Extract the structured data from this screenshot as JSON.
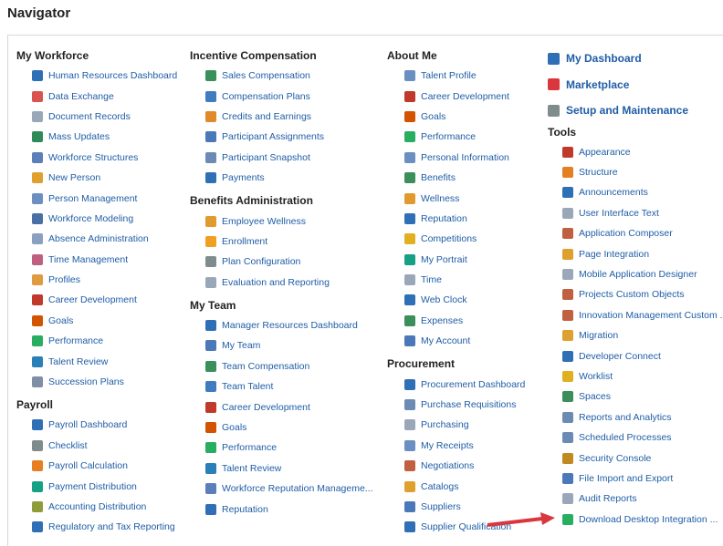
{
  "page": {
    "title": "Navigator"
  },
  "columns": [
    {
      "sections": [
        {
          "title": "My Workforce",
          "items": [
            {
              "label": "Human Resources Dashboard",
              "icon": "dashboard-icon",
              "color": "#2e6fb6"
            },
            {
              "label": "Data Exchange",
              "icon": "data-exchange-icon",
              "color": "#d9534f"
            },
            {
              "label": "Document Records",
              "icon": "document-icon",
              "color": "#9aa7b8"
            },
            {
              "label": "Mass Updates",
              "icon": "mass-update-icon",
              "color": "#2e8b57"
            },
            {
              "label": "Workforce Structures",
              "icon": "structures-icon",
              "color": "#5b7fb8"
            },
            {
              "label": "New Person",
              "icon": "new-person-icon",
              "color": "#e0a030"
            },
            {
              "label": "Person Management",
              "icon": "person-icon",
              "color": "#6a8fc0"
            },
            {
              "label": "Workforce Modeling",
              "icon": "modeling-icon",
              "color": "#4a6fa5"
            },
            {
              "label": "Absence Administration",
              "icon": "absence-icon",
              "color": "#8aa0c0"
            },
            {
              "label": "Time Management",
              "icon": "time-icon",
              "color": "#c06080"
            },
            {
              "label": "Profiles",
              "icon": "profiles-icon",
              "color": "#e09a40"
            },
            {
              "label": "Career Development",
              "icon": "career-icon",
              "color": "#c0392b"
            },
            {
              "label": "Goals",
              "icon": "goals-icon",
              "color": "#d35400"
            },
            {
              "label": "Performance",
              "icon": "performance-icon",
              "color": "#27ae60"
            },
            {
              "label": "Talent Review",
              "icon": "talent-review-icon",
              "color": "#2980b9"
            },
            {
              "label": "Succession Plans",
              "icon": "succession-icon",
              "color": "#7f8fa6"
            }
          ]
        },
        {
          "title": "Payroll",
          "items": [
            {
              "label": "Payroll Dashboard",
              "icon": "dashboard-icon",
              "color": "#2e6fb6"
            },
            {
              "label": "Checklist",
              "icon": "checklist-icon",
              "color": "#7f8c8d"
            },
            {
              "label": "Payroll Calculation",
              "icon": "calculation-icon",
              "color": "#e67e22"
            },
            {
              "label": "Payment Distribution",
              "icon": "payment-icon",
              "color": "#16a085"
            },
            {
              "label": "Accounting Distribution",
              "icon": "accounting-icon",
              "color": "#8e9d3a"
            },
            {
              "label": "Regulatory and Tax Reporting",
              "icon": "tax-icon",
              "color": "#2e6fb6"
            }
          ]
        }
      ]
    },
    {
      "sections": [
        {
          "title": "Incentive Compensation",
          "items": [
            {
              "label": "Sales Compensation",
              "icon": "sales-comp-icon",
              "color": "#3a8f5a"
            },
            {
              "label": "Compensation Plans",
              "icon": "comp-plans-icon",
              "color": "#3f7cc0"
            },
            {
              "label": "Credits and Earnings",
              "icon": "credits-icon",
              "color": "#e08a2a"
            },
            {
              "label": "Participant Assignments",
              "icon": "assignments-icon",
              "color": "#4a78b8"
            },
            {
              "label": "Participant Snapshot",
              "icon": "snapshot-icon",
              "color": "#6b8bb5"
            },
            {
              "label": "Payments",
              "icon": "payments-icon",
              "color": "#2e6fb6"
            }
          ]
        },
        {
          "title": "Benefits Administration",
          "items": [
            {
              "label": "Employee Wellness",
              "icon": "wellness-icon",
              "color": "#e09a30"
            },
            {
              "label": "Enrollment",
              "icon": "enrollment-icon",
              "color": "#f0a020"
            },
            {
              "label": "Plan Configuration",
              "icon": "plan-config-icon",
              "color": "#7f8c8d"
            },
            {
              "label": "Evaluation and Reporting",
              "icon": "evaluation-icon",
              "color": "#9aa7b8"
            }
          ]
        },
        {
          "title": "My Team",
          "items": [
            {
              "label": "Manager Resources Dashboard",
              "icon": "dashboard-icon",
              "color": "#2e6fb6"
            },
            {
              "label": "My Team",
              "icon": "team-icon",
              "color": "#4a78b8"
            },
            {
              "label": "Team Compensation",
              "icon": "team-comp-icon",
              "color": "#3a8f5a"
            },
            {
              "label": "Team Talent",
              "icon": "team-talent-icon",
              "color": "#3f7cc0"
            },
            {
              "label": "Career Development",
              "icon": "career-icon",
              "color": "#c0392b"
            },
            {
              "label": "Goals",
              "icon": "goals-icon",
              "color": "#d35400"
            },
            {
              "label": "Performance",
              "icon": "performance-icon",
              "color": "#27ae60"
            },
            {
              "label": "Talent Review",
              "icon": "talent-review-icon",
              "color": "#2980b9"
            },
            {
              "label": "Workforce Reputation Manageme...",
              "icon": "reputation-icon",
              "color": "#5b7fb8"
            },
            {
              "label": "Reputation",
              "icon": "reputation-icon",
              "color": "#2e6fb6"
            }
          ]
        }
      ]
    },
    {
      "sections": [
        {
          "title": "About Me",
          "items": [
            {
              "label": "Talent Profile",
              "icon": "talent-profile-icon",
              "color": "#6a8fc0"
            },
            {
              "label": "Career Development",
              "icon": "career-icon",
              "color": "#c0392b"
            },
            {
              "label": "Goals",
              "icon": "goals-icon",
              "color": "#d35400"
            },
            {
              "label": "Performance",
              "icon": "performance-icon",
              "color": "#27ae60"
            },
            {
              "label": "Personal Information",
              "icon": "personal-info-icon",
              "color": "#6a8fc0"
            },
            {
              "label": "Benefits",
              "icon": "benefits-icon",
              "color": "#3a8f5a"
            },
            {
              "label": "Wellness",
              "icon": "wellness-icon",
              "color": "#e09a30"
            },
            {
              "label": "Reputation",
              "icon": "reputation-icon",
              "color": "#2e6fb6"
            },
            {
              "label": "Competitions",
              "icon": "trophy-icon",
              "color": "#e0b020"
            },
            {
              "label": "My Portrait",
              "icon": "portrait-icon",
              "color": "#16a085"
            },
            {
              "label": "Time",
              "icon": "time-icon",
              "color": "#9aa7b8"
            },
            {
              "label": "Web Clock",
              "icon": "clock-icon",
              "color": "#2e6fb6"
            },
            {
              "label": "Expenses",
              "icon": "expenses-icon",
              "color": "#3a8f5a"
            },
            {
              "label": "My Account",
              "icon": "account-icon",
              "color": "#4a78b8"
            }
          ]
        },
        {
          "title": "Procurement",
          "items": [
            {
              "label": "Procurement Dashboard",
              "icon": "dashboard-icon",
              "color": "#2e6fb6"
            },
            {
              "label": "Purchase Requisitions",
              "icon": "requisitions-icon",
              "color": "#6b8bb5"
            },
            {
              "label": "Purchasing",
              "icon": "purchasing-icon",
              "color": "#9aa7b8"
            },
            {
              "label": "My Receipts",
              "icon": "receipts-icon",
              "color": "#6a8fc0"
            },
            {
              "label": "Negotiations",
              "icon": "negotiations-icon",
              "color": "#c06040"
            },
            {
              "label": "Catalogs",
              "icon": "catalogs-icon",
              "color": "#e0a030"
            },
            {
              "label": "Suppliers",
              "icon": "suppliers-icon",
              "color": "#4a78b8"
            },
            {
              "label": "Supplier Qualification",
              "icon": "qualification-icon",
              "color": "#2e6fb6"
            }
          ]
        }
      ]
    }
  ],
  "right_column": {
    "links": [
      {
        "label": "My Dashboard",
        "icon": "dashboard-icon",
        "color": "#2e6fb6"
      },
      {
        "label": "Marketplace",
        "icon": "marketplace-icon",
        "color": "#d9363e"
      },
      {
        "label": "Setup and Maintenance",
        "icon": "gears-icon",
        "color": "#7f8c8d"
      }
    ],
    "tools": {
      "title": "Tools",
      "items": [
        {
          "label": "Appearance",
          "icon": "appearance-icon",
          "color": "#c0392b"
        },
        {
          "label": "Structure",
          "icon": "structure-icon",
          "color": "#e67e22"
        },
        {
          "label": "Announcements",
          "icon": "announcements-icon",
          "color": "#2e6fb6"
        },
        {
          "label": "User Interface Text",
          "icon": "ui-text-icon",
          "color": "#9aa7b8"
        },
        {
          "label": "Application Composer",
          "icon": "composer-icon",
          "color": "#c06040"
        },
        {
          "label": "Page Integration",
          "icon": "page-integration-icon",
          "color": "#e0a030"
        },
        {
          "label": "Mobile Application Designer",
          "icon": "mobile-designer-icon",
          "color": "#9aa7b8"
        },
        {
          "label": "Projects Custom Objects",
          "icon": "projects-icon",
          "color": "#c06040"
        },
        {
          "label": "Innovation Management Custom ...",
          "icon": "innovation-icon",
          "color": "#c06040"
        },
        {
          "label": "Migration",
          "icon": "migration-icon",
          "color": "#e0a030"
        },
        {
          "label": "Developer Connect",
          "icon": "developer-icon",
          "color": "#2e6fb6"
        },
        {
          "label": "Worklist",
          "icon": "worklist-icon",
          "color": "#e0b020"
        },
        {
          "label": "Spaces",
          "icon": "spaces-icon",
          "color": "#3a8f5a"
        },
        {
          "label": "Reports and Analytics",
          "icon": "reports-icon",
          "color": "#6b8bb5"
        },
        {
          "label": "Scheduled Processes",
          "icon": "scheduled-icon",
          "color": "#6b8bb5"
        },
        {
          "label": "Security Console",
          "icon": "security-icon",
          "color": "#c08a20"
        },
        {
          "label": "File Import and Export",
          "icon": "file-import-icon",
          "color": "#4a78b8"
        },
        {
          "label": "Audit Reports",
          "icon": "audit-icon",
          "color": "#9aa7b8"
        },
        {
          "label": "Download Desktop Integration ...",
          "icon": "download-icon",
          "color": "#27ae60"
        }
      ]
    }
  },
  "annotation": {
    "arrow_color": "#d9363e"
  }
}
